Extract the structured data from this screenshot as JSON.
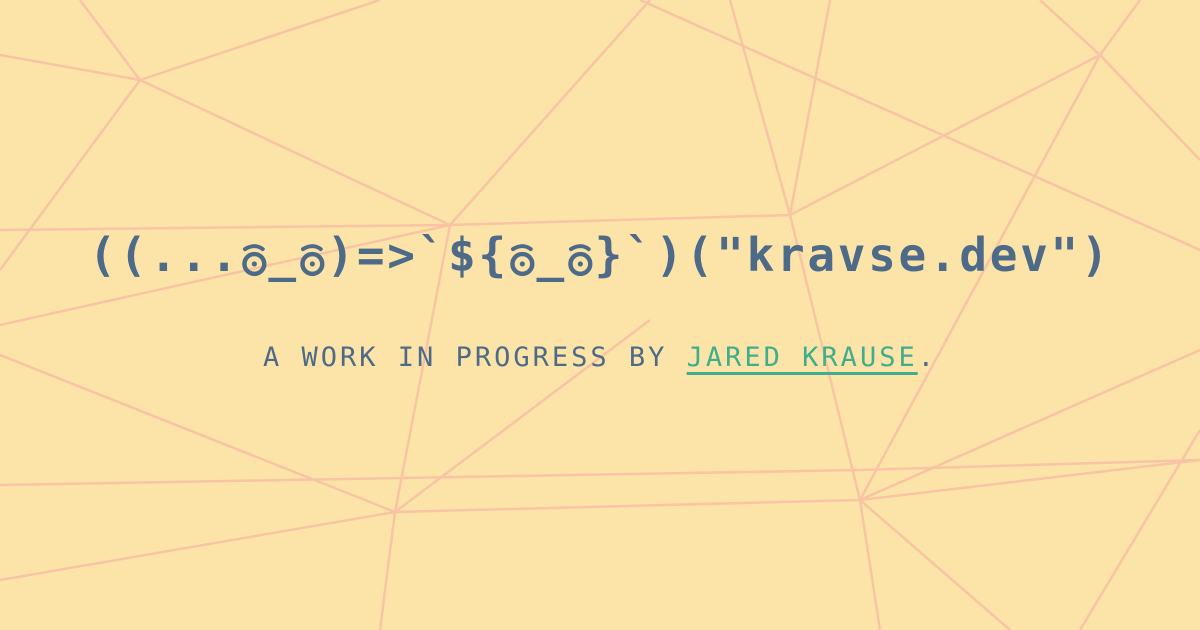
{
  "title": "((...ಠ_ಠ)=>`${ಠ_ಠ}`)(\"kravse.dev\")",
  "subtitle": {
    "prefix": "A WORK IN PROGRESS BY ",
    "author_link": "JARED KRAUSE",
    "suffix": "."
  },
  "colors": {
    "background": "#fce4a8",
    "text": "#4e6a89",
    "link": "#3fae8b",
    "lines": "#f8c4a4"
  }
}
